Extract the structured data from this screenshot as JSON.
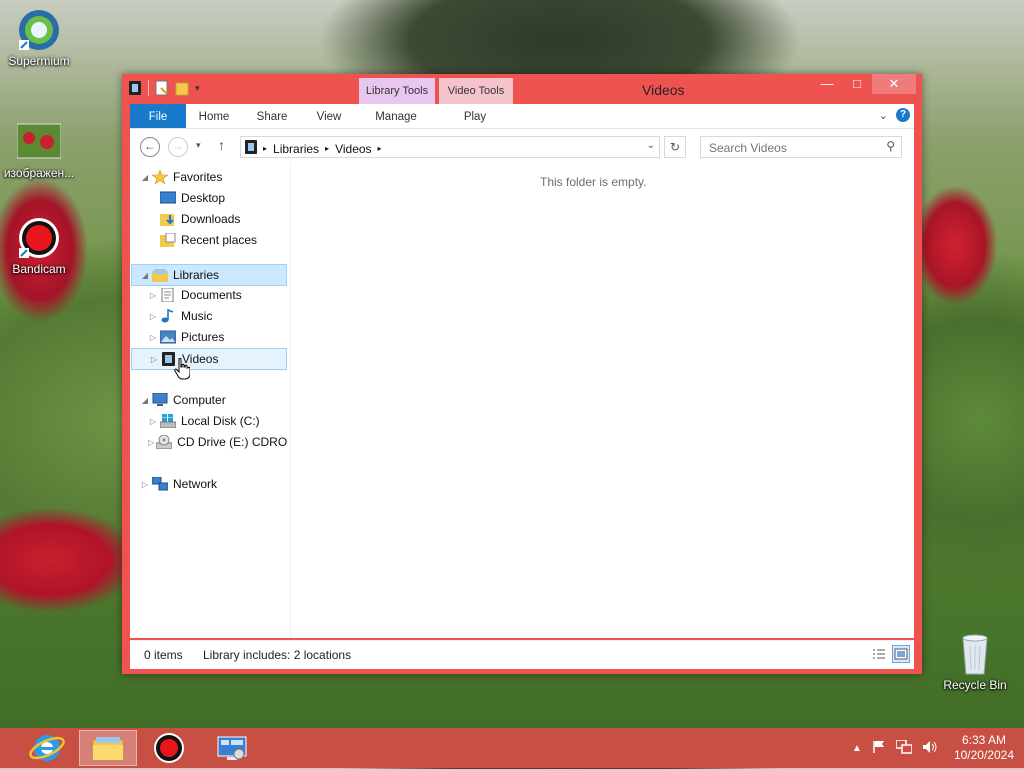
{
  "desktop": {
    "icons": [
      {
        "label": "Supermium"
      },
      {
        "label": "изображен..."
      },
      {
        "label": "Bandicam"
      },
      {
        "label": "Recycle Bin"
      }
    ]
  },
  "window": {
    "title": "Videos",
    "context_tabs": {
      "library_tools": "Library Tools",
      "video_tools": "Video Tools"
    },
    "ribbon_tabs": {
      "file": "File",
      "home": "Home",
      "share": "Share",
      "view": "View",
      "manage": "Manage",
      "play": "Play"
    },
    "address": {
      "crumbs": [
        "Libraries",
        "Videos"
      ]
    },
    "search": {
      "placeholder": "Search Videos"
    },
    "nav": {
      "favorites": "Favorites",
      "desktop": "Desktop",
      "downloads": "Downloads",
      "recent": "Recent places",
      "libraries": "Libraries",
      "documents": "Documents",
      "music": "Music",
      "pictures": "Pictures",
      "videos": "Videos",
      "computer": "Computer",
      "local_disk": "Local Disk (C:)",
      "cd_drive": "CD Drive (E:) CDROM",
      "network": "Network"
    },
    "empty_message": "This folder is empty.",
    "status": {
      "items": "0 items",
      "library_info": "Library includes: 2 locations"
    }
  },
  "taskbar": {
    "clock_time": "6:33 AM",
    "clock_date": "10/20/2024"
  },
  "colors": {
    "accent": "#1979ca",
    "window_frame": "#ef5350",
    "taskbar": "#d24e46"
  }
}
